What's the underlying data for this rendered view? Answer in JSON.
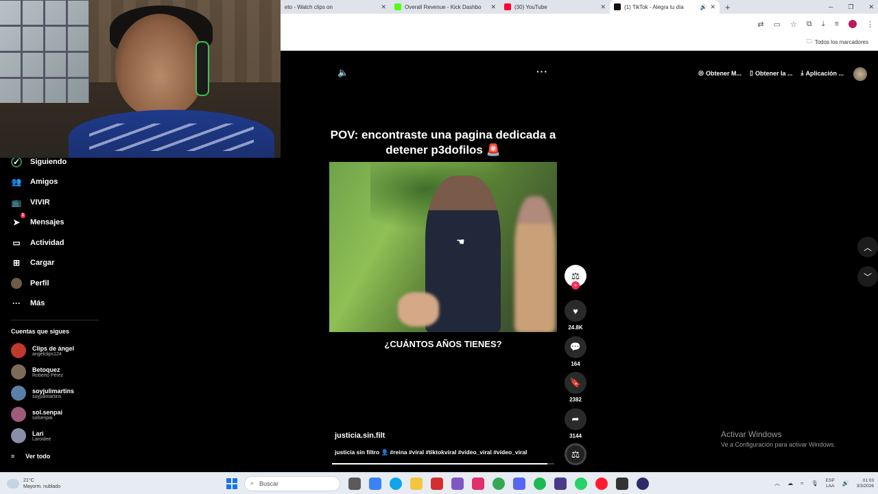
{
  "browser": {
    "tabs": [
      {
        "title": "eto - Watch clips on",
        "icon_color": "#e5e7eb"
      },
      {
        "title": "Overall Revenue - Kick Dashbo",
        "icon_color": "#53fc18"
      },
      {
        "title": "(30) YouTube",
        "icon_color": "#ff0033"
      },
      {
        "title": "(1) TikTok - Alegra tu día",
        "icon_color": "#111111"
      }
    ],
    "new_tab": "+",
    "bookmarks_label": "Todos los marcadores"
  },
  "sidebar": {
    "items": [
      {
        "label": "Siguiendo",
        "icon": "following-icon"
      },
      {
        "label": "Amigos",
        "icon": "friends-icon"
      },
      {
        "label": "VIVIR",
        "icon": "live-icon"
      },
      {
        "label": "Mensajes",
        "icon": "messages-icon",
        "badge": "1"
      },
      {
        "label": "Actividad",
        "icon": "activity-icon"
      },
      {
        "label": "Cargar",
        "icon": "upload-icon"
      },
      {
        "label": "Perfil",
        "icon": "profile-icon"
      },
      {
        "label": "Más",
        "icon": "more-icon"
      }
    ],
    "following_title": "Cuentas que sigues",
    "accounts": [
      {
        "name": "Clips de ángel",
        "handle": "angelclips124",
        "color": "#c0392b"
      },
      {
        "name": "Betoquez",
        "handle": "Roberto Pérez",
        "color": "#7d6b5a"
      },
      {
        "name": "soyjulimartins",
        "handle": "soyjulimartins",
        "color": "#5b7fa6"
      },
      {
        "name": "sol.senpai",
        "handle": "solsenpai",
        "color": "#a05a7a"
      },
      {
        "name": "Lari",
        "handle": "Laroidee",
        "color": "#8a8fa8"
      }
    ],
    "see_all": "Ver todo"
  },
  "top_actions": {
    "get_coins": "Obtener M...",
    "get_app": "Obtener la ...",
    "app": "Aplicación ..."
  },
  "video": {
    "caption_top": "POV: encontraste una pagina dedicada a detener p3dofilos 🚨",
    "caption_bottom": "¿CUÁNTOS AÑOS TIENES?",
    "author": "justicia.sin.filt",
    "description": "justicia sin filtro 👤 #reina #viral #tiktokviral #vídeo_viral #vídeo_viral",
    "progress": 0.97,
    "likes": "24.8K",
    "comments": "164",
    "saves": "2382",
    "shares": "3144"
  },
  "activation": {
    "title": "Activar Windows",
    "subtitle": "Ve a Configuración para activar Windows."
  },
  "taskbar": {
    "weather_temp": "21°C",
    "weather_desc": "Mayorm. nublado",
    "search_placeholder": "Buscar",
    "lang_top": "ESP",
    "lang_bottom": "LAA",
    "time": "01:03",
    "date": "3/3/2026"
  }
}
